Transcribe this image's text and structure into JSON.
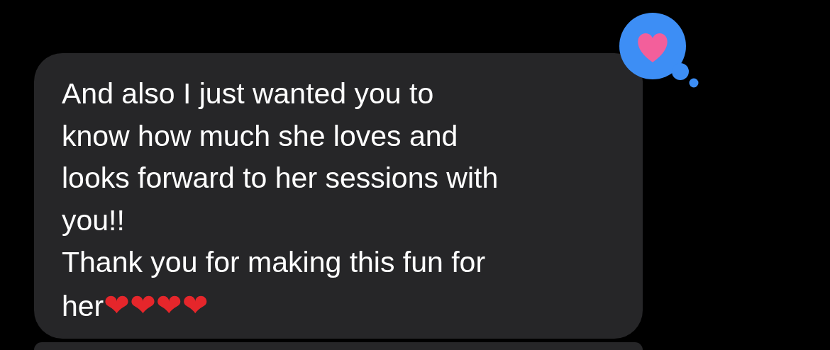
{
  "message": {
    "text": "And also I just wanted you to\nknow how much she loves and\nlooks forward to her sessions with\nyou!!\nThank you for making this fun for\nher",
    "emoji": [
      "❤",
      "❤",
      "❤",
      "❤"
    ]
  },
  "tapback": {
    "kind": "heart"
  }
}
